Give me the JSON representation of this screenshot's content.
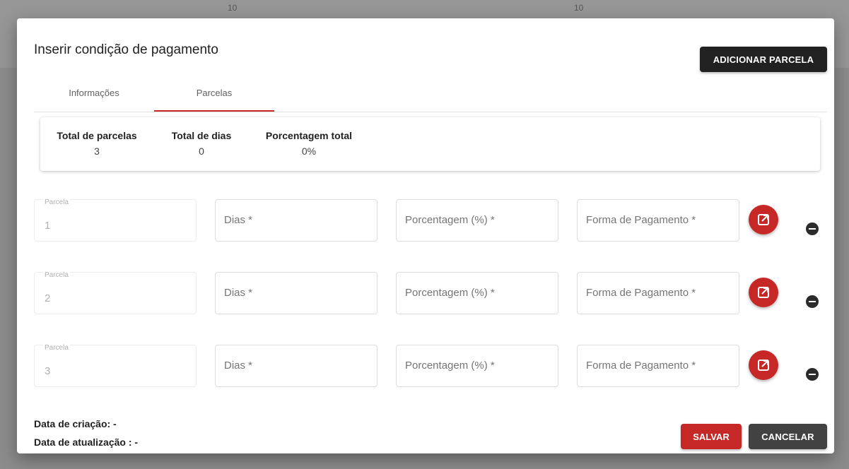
{
  "background": {
    "col_a": "10",
    "col_b": "10"
  },
  "modal": {
    "title": "Inserir condição de pagamento",
    "add_button": "ADICIONAR PARCELA",
    "tabs": [
      {
        "label": "Informações",
        "active": false
      },
      {
        "label": "Parcelas",
        "active": true
      }
    ],
    "summary": {
      "total_parcelas_label": "Total de parcelas",
      "total_parcelas_value": "3",
      "total_dias_label": "Total de dias",
      "total_dias_value": "0",
      "porcentagem_label": "Porcentagem total",
      "porcentagem_value": "0%"
    },
    "rows": [
      {
        "parcela_label": "Parcela",
        "parcela_value": "1",
        "dias_placeholder": "Dias *",
        "porcentagem_placeholder": "Porcentagem (%) *",
        "forma_placeholder": "Forma de Pagamento *"
      },
      {
        "parcela_label": "Parcela",
        "parcela_value": "2",
        "dias_placeholder": "Dias *",
        "porcentagem_placeholder": "Porcentagem (%) *",
        "forma_placeholder": "Forma de Pagamento *"
      },
      {
        "parcela_label": "Parcela",
        "parcela_value": "3",
        "dias_placeholder": "Dias *",
        "porcentagem_placeholder": "Porcentagem (%) *",
        "forma_placeholder": "Forma de Pagamento *"
      }
    ],
    "icons": {
      "edit": "open-in-new-icon",
      "remove": "minus-circle-icon"
    },
    "footer": {
      "created": "Data de criação: -",
      "updated": "Data de atualização : -",
      "save_label": "SALVAR",
      "cancel_label": "CANCELAR"
    },
    "colors": {
      "accent": "#c62828",
      "dark": "#212121"
    }
  }
}
